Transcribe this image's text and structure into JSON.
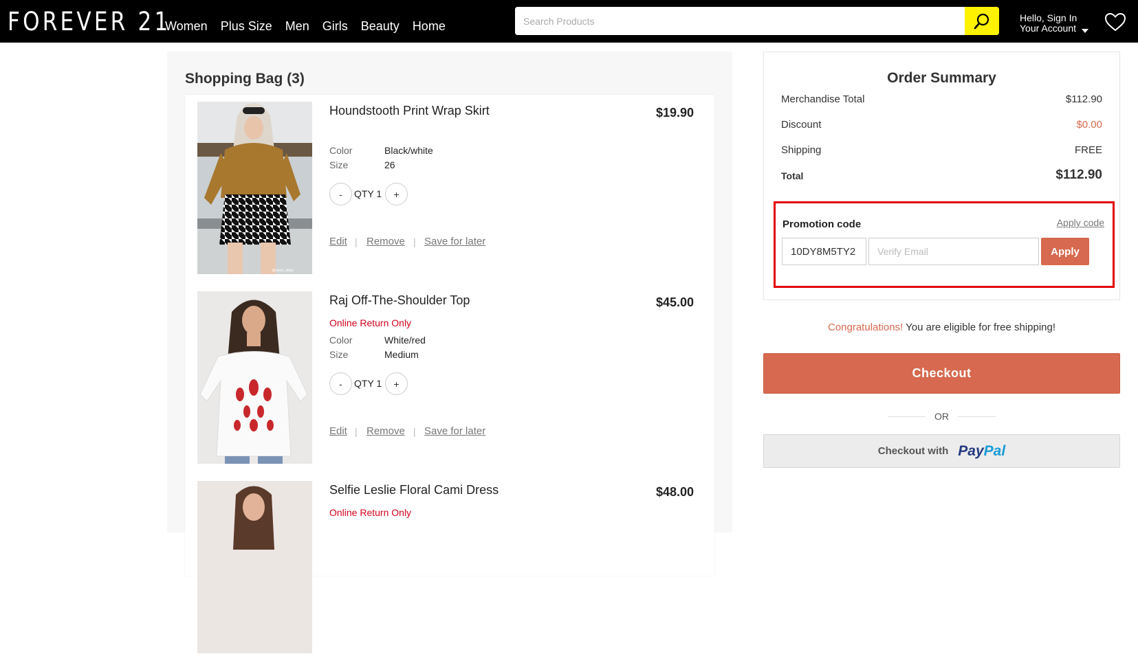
{
  "header": {
    "logo": "FOREVER 21",
    "nav": [
      "Women",
      "Plus Size",
      "Men",
      "Girls",
      "Beauty",
      "Home"
    ],
    "search_placeholder": "Search Products",
    "account_line1": "Hello, Sign In",
    "account_line2": "Your Account"
  },
  "bag": {
    "title": "Shopping Bag (3)",
    "labels": {
      "color": "Color",
      "size": "Size",
      "qty_prefix": "QTY",
      "minus": "-",
      "plus": "+",
      "edit": "Edit",
      "remove": "Remove",
      "save": "Save for later",
      "sep": "|"
    },
    "items": [
      {
        "name": "Houndstooth Print Wrap Skirt",
        "price": "$19.90",
        "note": "",
        "color": "Black/white",
        "size": "26",
        "qty": "1",
        "image_credit": "@steph_allain"
      },
      {
        "name": "Raj Off-The-Shoulder Top",
        "price": "$45.00",
        "note": "Online Return Only",
        "color": "White/red",
        "size": "Medium",
        "qty": "1"
      },
      {
        "name": "Selfie Leslie Floral Cami Dress",
        "price": "$48.00",
        "note": "Online Return Only"
      }
    ]
  },
  "summary": {
    "title": "Order Summary",
    "rows": [
      {
        "label": "Merchandise Total",
        "value": "$112.90"
      },
      {
        "label": "Discount",
        "value": "$0.00"
      },
      {
        "label": "Shipping",
        "value": "FREE"
      },
      {
        "label": "Total",
        "value": "$112.90"
      }
    ],
    "promo": {
      "label": "Promotion code",
      "apply_code_link": "Apply code",
      "code_value": "10DY8M5TY2",
      "email_placeholder": "Verify Email",
      "apply_button": "Apply"
    }
  },
  "congrats": {
    "highlight": "Congratulations!",
    "text": " You are eligible for free shipping!"
  },
  "checkout_button": "Checkout",
  "or_text": "OR",
  "paypal": {
    "prefix": "Checkout with",
    "brand_pay": "Pay",
    "brand_pal": "Pal"
  },
  "colors": {
    "accent": "#d6694f",
    "search_button": "#fef200",
    "alert_red": "#d0021b",
    "highlight_border": "#e00000",
    "header_bg": "#000000"
  }
}
